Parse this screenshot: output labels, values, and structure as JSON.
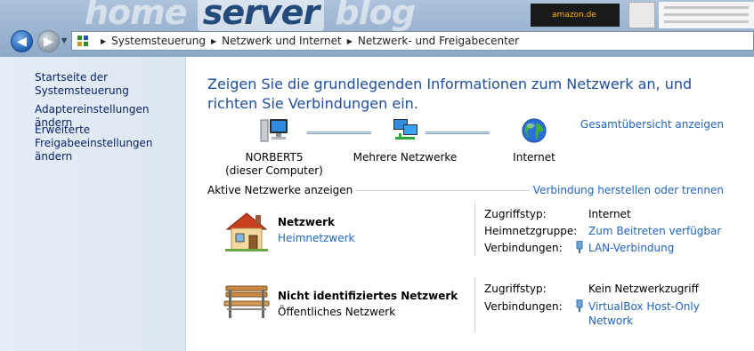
{
  "chrome": {
    "banner_text_1": "home",
    "banner_text_2": "server",
    "banner_text_3": "blog",
    "ad_text": "amazon.de"
  },
  "breadcrumb": [
    "Systemsteuerung",
    "Netzwerk und Internet",
    "Netzwerk- und Freigabecenter"
  ],
  "sidebar": {
    "items": [
      {
        "label": "Startseite der Systemsteuerung"
      },
      {
        "label": "Adaptereinstellungen ändern"
      },
      {
        "label": "Erweiterte Freigabeeinstellungen ändern"
      }
    ]
  },
  "main": {
    "heading": "Zeigen Sie die grundlegenden Informationen zum Netzwerk an, und richten Sie Verbindungen ein.",
    "full_map_link": "Gesamtübersicht anzeigen",
    "map": {
      "computer_name": "NORBERT5",
      "computer_note": "(dieser Computer)",
      "network": "Mehrere Netzwerke",
      "internet": "Internet"
    },
    "active_label": "Aktive Netzwerke anzeigen",
    "connect_link": "Verbindung herstellen oder trennen",
    "networks": [
      {
        "name": "Netzwerk",
        "type": "Heimnetzwerk",
        "icon": "house-icon",
        "access_label": "Zugriffstyp:",
        "access_value": "Internet",
        "homegroup_label": "Heimnetzgruppe:",
        "homegroup_value": "Zum Beitreten verfügbar",
        "conn_label": "Verbindungen:",
        "conn_value": "LAN-Verbindung"
      },
      {
        "name": "Nicht identifiziertes Netzwerk",
        "type": "Öffentliches Netzwerk",
        "icon": "park-bench-icon",
        "access_label": "Zugriffstyp:",
        "access_value": "Kein Netzwerkzugriff",
        "conn_label": "Verbindungen:",
        "conn_value_line1": "VirtualBox Host-Only",
        "conn_value_line2": "Network"
      }
    ]
  },
  "colors": {
    "heading": "#1e4fa0",
    "link": "#1f64c4",
    "sidebar_bg": "#e4ecf7"
  }
}
